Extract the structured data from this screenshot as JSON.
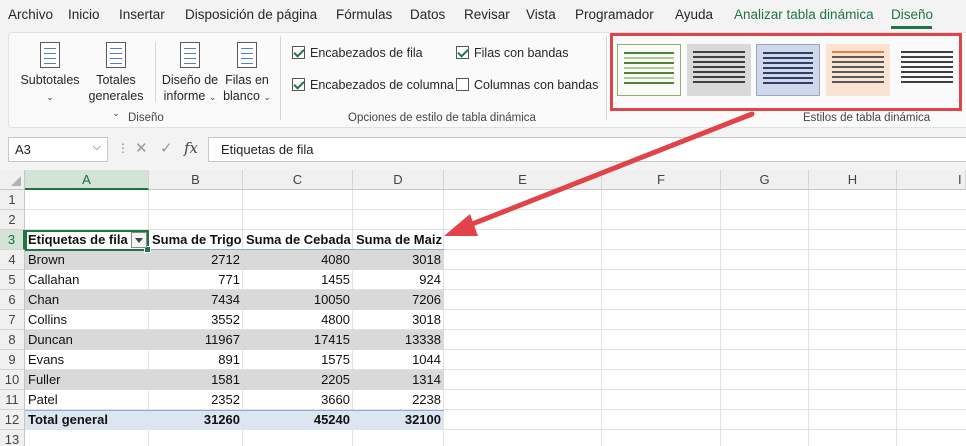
{
  "menu": {
    "items": [
      "Archivo",
      "Inicio",
      "Insertar",
      "Disposición de página",
      "Fórmulas",
      "Datos",
      "Revisar",
      "Vista",
      "Programador",
      "Ayuda",
      "Analizar tabla dinámica",
      "Diseño"
    ],
    "active": "Diseño"
  },
  "ribbon": {
    "layout_group": {
      "label": "Diseño",
      "buttons": [
        {
          "line1": "Subtotales",
          "line2": ""
        },
        {
          "line1": "Totales",
          "line2": "generales"
        },
        {
          "line1": "Diseño de",
          "line2": "informe"
        },
        {
          "line1": "Filas en",
          "line2": "blanco"
        }
      ]
    },
    "options_group": {
      "label": "Opciones de estilo de tabla dinámica",
      "row_headers": {
        "label": "Encabezados de fila",
        "checked": true
      },
      "col_headers": {
        "label": "Encabezados de columna",
        "checked": true
      },
      "banded_rows": {
        "label": "Filas con bandas",
        "checked": true
      },
      "banded_cols": {
        "label": "Columnas con bandas",
        "checked": false
      }
    },
    "styles_group": {
      "label": "Estilos de tabla dinámica",
      "swatch_colors": [
        "#548235",
        "#595959",
        "#4472c4",
        "#ed7d31",
        "#404040"
      ],
      "selected_index": 2
    }
  },
  "formula_bar": {
    "name_box": "A3",
    "formula": "Etiquetas de fila",
    "fx_label": "fx"
  },
  "columns": [
    "A",
    "B",
    "C",
    "D",
    "E",
    "F",
    "G",
    "H",
    "I"
  ],
  "rows": [
    "1",
    "2",
    "3",
    "4",
    "5",
    "6",
    "7",
    "8",
    "9",
    "10",
    "11",
    "12",
    "13"
  ],
  "pivot": {
    "headers": [
      "Etiquetas de fila",
      "Suma de Trigo",
      "Suma de Cebada",
      "Suma de Maiz"
    ],
    "data": [
      [
        "Brown",
        "2712",
        "4080",
        "3018"
      ],
      [
        "Callahan",
        "771",
        "1455",
        "924"
      ],
      [
        "Chan",
        "7434",
        "10050",
        "7206"
      ],
      [
        "Collins",
        "3552",
        "4800",
        "3018"
      ],
      [
        "Duncan",
        "11967",
        "17415",
        "13338"
      ],
      [
        "Evans",
        "891",
        "1575",
        "1044"
      ],
      [
        "Fuller",
        "1581",
        "2205",
        "1314"
      ],
      [
        "Patel",
        "2352",
        "3660",
        "2238"
      ]
    ],
    "total": [
      "Total general",
      "31260",
      "45240",
      "32100"
    ]
  },
  "colors": {
    "accent": "#217346",
    "highlight": "#e0434a",
    "band": "#d9d9d9",
    "total_fill": "#dce6f1"
  }
}
